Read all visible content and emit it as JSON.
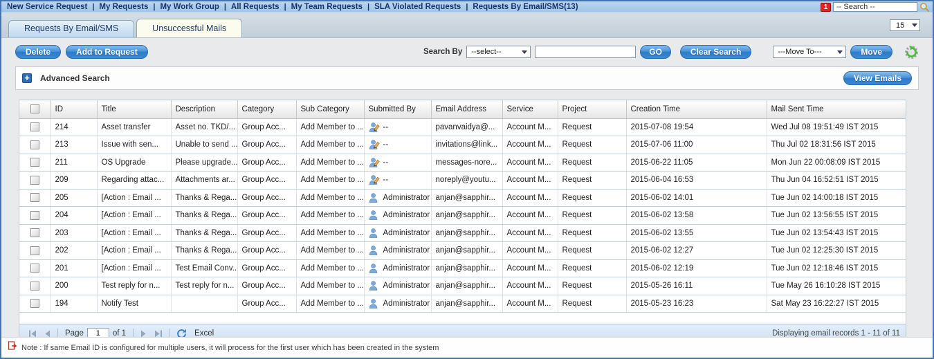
{
  "nav": {
    "items": [
      "New Service Request",
      "My Requests",
      "My Work Group",
      "All Requests",
      "My Team Requests",
      "SLA Violated Requests",
      "Requests By Email/SMS(13)"
    ],
    "active_index": 6,
    "badge": "1",
    "search_placeholder": "-- Search --"
  },
  "tabs": {
    "items": [
      {
        "label": "Requests By Email/SMS",
        "active": false
      },
      {
        "label": "Unsuccessful Mails",
        "active": true
      }
    ],
    "page_size": "15"
  },
  "toolbar": {
    "delete_label": "Delete",
    "add_to_request_label": "Add to Request",
    "search_by_label": "Search By",
    "search_by_value": "--select--",
    "search_input_value": "",
    "go_label": "GO",
    "clear_search_label": "Clear Search",
    "move_to_value": "---Move To---",
    "move_label": "Move",
    "refresh_settings_icon": "gear-refresh-icon"
  },
  "advanced_search": {
    "label": "Advanced Search",
    "view_emails_label": "View Emails"
  },
  "table": {
    "columns": [
      "ID",
      "Title",
      "Description",
      "Category",
      "Sub Category",
      "Submitted By",
      "Email Address",
      "Service",
      "Project",
      "Creation Time",
      "Mail Sent Time"
    ],
    "rows": [
      {
        "id": "214",
        "title": "Asset transfer",
        "description": "Asset no. TKD/...",
        "category": "Group Acc...",
        "sub_category": "Add Member to ...",
        "submitted_icon": "user-edit",
        "submitted_by": "--",
        "email": "pavanvaidya@...",
        "service": "Account M...",
        "project": "Request",
        "creation_time": "2015-07-08 19:54",
        "mail_sent_time": "Wed Jul 08 19:51:49 IST 2015"
      },
      {
        "id": "213",
        "title": "Issue with sen...",
        "description": "Unable to send ...",
        "category": "Group Acc...",
        "sub_category": "Add Member to ...",
        "submitted_icon": "user-edit",
        "submitted_by": "--",
        "email": "invitations@link...",
        "service": "Account M...",
        "project": "Request",
        "creation_time": "2015-07-06 11:00",
        "mail_sent_time": "Thu Jul 02 18:31:56 IST 2015"
      },
      {
        "id": "211",
        "title": "OS Upgrade",
        "description": "Please upgrade...",
        "category": "Group Acc...",
        "sub_category": "Add Member to ...",
        "submitted_icon": "user-edit",
        "submitted_by": "--",
        "email": "messages-nore...",
        "service": "Account M...",
        "project": "Request",
        "creation_time": "2015-06-22 11:05",
        "mail_sent_time": "Mon Jun 22 00:08:09 IST 2015"
      },
      {
        "id": "209",
        "title": "Regarding attac...",
        "description": "Attachments ar...",
        "category": "Group Acc...",
        "sub_category": "Add Member to ...",
        "submitted_icon": "user-edit",
        "submitted_by": "--",
        "email": "noreply@youtu...",
        "service": "Account M...",
        "project": "Request",
        "creation_time": "2015-06-04 16:53",
        "mail_sent_time": "Thu Jun 04 16:52:51 IST 2015"
      },
      {
        "id": "205",
        "title": "[Action : Email ...",
        "description": "Thanks & Rega...",
        "category": "Group Acc...",
        "sub_category": "Add Member to ...",
        "submitted_icon": "user",
        "submitted_by": "Administrator",
        "email": "anjan@sapphir...",
        "service": "Account M...",
        "project": "Request",
        "creation_time": "2015-06-02 14:01",
        "mail_sent_time": "Tue Jun 02 14:00:18 IST 2015"
      },
      {
        "id": "204",
        "title": "[Action : Email ...",
        "description": "Thanks & Rega...",
        "category": "Group Acc...",
        "sub_category": "Add Member to ...",
        "submitted_icon": "user",
        "submitted_by": "Administrator",
        "email": "anjan@sapphir...",
        "service": "Account M...",
        "project": "Request",
        "creation_time": "2015-06-02 13:58",
        "mail_sent_time": "Tue Jun 02 13:56:55 IST 2015"
      },
      {
        "id": "203",
        "title": "[Action : Email ...",
        "description": "Thanks & Rega...",
        "category": "Group Acc...",
        "sub_category": "Add Member to ...",
        "submitted_icon": "user",
        "submitted_by": "Administrator",
        "email": "anjan@sapphir...",
        "service": "Account M...",
        "project": "Request",
        "creation_time": "2015-06-02 13:55",
        "mail_sent_time": "Tue Jun 02 13:54:43 IST 2015"
      },
      {
        "id": "202",
        "title": "[Action : Email ...",
        "description": "Thanks & Rega...",
        "category": "Group Acc...",
        "sub_category": "Add Member to ...",
        "submitted_icon": "user",
        "submitted_by": "Administrator",
        "email": "anjan@sapphir...",
        "service": "Account M...",
        "project": "Request",
        "creation_time": "2015-06-02 12:27",
        "mail_sent_time": "Tue Jun 02 12:25:30 IST 2015"
      },
      {
        "id": "201",
        "title": "[Action : Email ...",
        "description": "Test Email Conv...",
        "category": "Group Acc...",
        "sub_category": "Add Member to ...",
        "submitted_icon": "user",
        "submitted_by": "Administrator",
        "email": "anjan@sapphir...",
        "service": "Account M...",
        "project": "Request",
        "creation_time": "2015-06-02 12:19",
        "mail_sent_time": "Tue Jun 02 12:18:46 IST 2015"
      },
      {
        "id": "200",
        "title": "Test reply for n...",
        "description": "Test reply for n...",
        "category": "Group Acc...",
        "sub_category": "Add Member to ...",
        "submitted_icon": "user",
        "submitted_by": "Administrator",
        "email": "anjan@sapphir...",
        "service": "Account M...",
        "project": "Request",
        "creation_time": "2015-05-26 16:11",
        "mail_sent_time": "Tue May 26 16:10:28 IST 2015"
      },
      {
        "id": "194",
        "title": "Notify Test",
        "description": "",
        "category": "Group Acc...",
        "sub_category": "Add Member to ...",
        "submitted_icon": "user",
        "submitted_by": "Administrator",
        "email": "anjan@sapphir...",
        "service": "Account M...",
        "project": "Request",
        "creation_time": "2015-05-23 16:23",
        "mail_sent_time": "Sat May 23 16:22:27 IST 2015"
      }
    ]
  },
  "pagination": {
    "page_label": "Page",
    "page_value": "1",
    "of_label": "of 1",
    "excel_label": "Excel",
    "records_summary": "Displaying email records 1 - 11 of 11"
  },
  "note": {
    "text": "Note : If same Email ID is configured for multiple users, it will process for the first user which has been created in the system"
  },
  "colors": {
    "window_border": "#4272b4",
    "nav_bg": "#aecbe8",
    "nav_text": "#16366e",
    "badge_red": "#e8211d",
    "button_blue": "#2e7ac8",
    "tab_active_bg": "#fcfcee",
    "footer_bg": "#cfe1f2",
    "row_border": "#bfd2e2",
    "refresh_green": "#4cbb3c"
  }
}
